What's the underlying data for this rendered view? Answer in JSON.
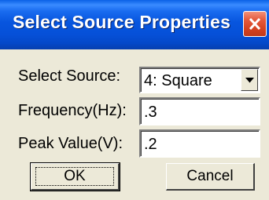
{
  "window": {
    "title": "Select Source Properties",
    "close_icon": "close-x-icon"
  },
  "form": {
    "source": {
      "label": "Select Source:",
      "value": "4: Square"
    },
    "frequency": {
      "label": "Frequency(Hz):",
      "value": ".3"
    },
    "peak": {
      "label": "Peak Value(V):",
      "value": ".2"
    }
  },
  "buttons": {
    "ok": "OK",
    "cancel": "Cancel"
  },
  "colors": {
    "titlebar": "#0755de",
    "close": "#d2401e",
    "dialog_bg": "#ece9d8"
  }
}
